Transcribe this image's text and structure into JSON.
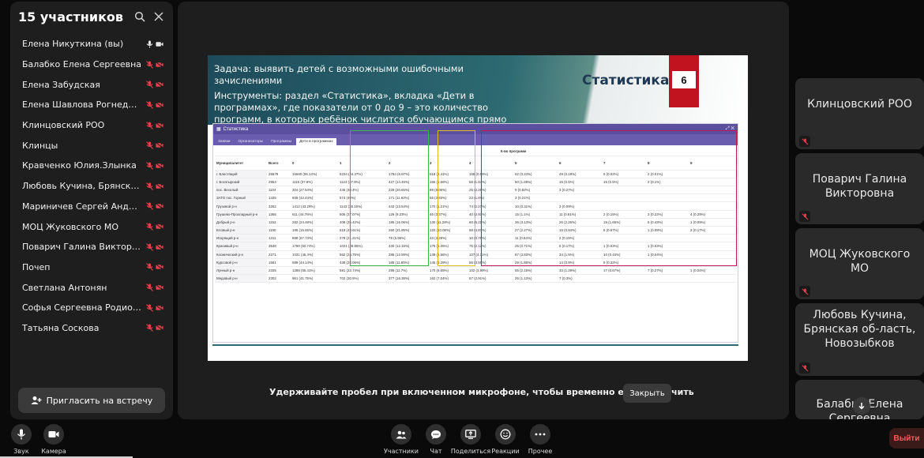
{
  "sidebar": {
    "title": "15 участников",
    "invite_label": "Пригласить на встречу",
    "participants": [
      {
        "name": "Елена Никуткина (вы)",
        "muted": false
      },
      {
        "name": "Балабко Елена Сергеевна",
        "muted": true
      },
      {
        "name": "Елена Забудская",
        "muted": true
      },
      {
        "name": "Елена Шавлова Рогнедино",
        "muted": true
      },
      {
        "name": "Клинцовский РОО",
        "muted": true
      },
      {
        "name": "Клинцы",
        "muted": true
      },
      {
        "name": "Кравченко Юлия.Злынка",
        "muted": true
      },
      {
        "name": "Любовь Кучина, Брянская ...",
        "muted": true
      },
      {
        "name": "Мариничев Сергей Андрее...",
        "muted": true
      },
      {
        "name": "МОЦ Жуковского МО",
        "muted": true
      },
      {
        "name": "Поварич Галина Викторовна",
        "muted": true
      },
      {
        "name": "Почеп",
        "muted": true
      },
      {
        "name": "Светлана Антонян",
        "muted": true
      },
      {
        "name": "Софья Сергеевна Родионе...",
        "muted": true
      },
      {
        "name": "Татьяна Соскова",
        "muted": true
      }
    ]
  },
  "slide": {
    "task_line": "Задача: выявить детей с возможными ошибочными зачислениями",
    "tools_line": "Инструменты: раздел «Статистика», вкладка «Дети в программах», где показатели от 0 до 9 – это количество программ, в которых ребёнок числится обучающимся прямо сейчас",
    "title": "Статистика",
    "slide_number": "6",
    "app_title": "Статистика",
    "tabs": [
      "Заявки",
      "Организаторы",
      "Программы",
      "Дети в программах"
    ],
    "group_header": "К-во программ",
    "columns": [
      "Муниципалитет",
      "Всего",
      "0",
      "1",
      "2",
      "3",
      "4",
      "5",
      "6",
      "7",
      "8",
      "9"
    ],
    "rows": [
      [
        "г. Блестящий",
        "25579",
        "16660 (65.13%)",
        "6234 (24.37%)",
        "1784 (6.97%)",
        "616 (2.41%)",
        "165 (0.65%)",
        "62 (0.24%)",
        "49 (0.19%)",
        "6 (0.02%)",
        "2 (0.01%)",
        ""
      ],
      [
        "г. Богатырский",
        "2954",
        "1116 (37.8%)",
        "1123 (37.8%)",
        "427 (14.45%)",
        "166 (5.56%)",
        "58 (1.84%)",
        "50 (1.69%)",
        "15 (0.5%)",
        "15 (0.5%)",
        "2 (0.1%)",
        ""
      ],
      [
        "пос. Веселый",
        "1104",
        "304 (27.54%)",
        "446 (40.4%)",
        "228 (20.65%)",
        "89 (8.06%)",
        "25 (2.26%)",
        "9 (0.82%)",
        "3 (0.27%)",
        "",
        "",
        ""
      ],
      [
        "ЗАТО пос. Горный",
        "1435",
        "609 (42.44%)",
        "574 (40%)",
        "171 (11.92%)",
        "55 (3.83%)",
        "23 (1.6%)",
        "3 (0.21%)",
        "",
        "",
        "",
        ""
      ],
      [
        "Грузовой р-н",
        "3262",
        "1412 (43.29%)",
        "1143 (35.15%)",
        "443 (13.54%)",
        "170 (5.21%)",
        "74 (2.27%)",
        "10 (0.31%)",
        "3 (0.09%)",
        "",
        "",
        ""
      ],
      [
        "Грушево-Прохладный р-н",
        "1365",
        "611 (44.76%)",
        "506 (37.07%)",
        "126 (9.23%)",
        "46 (3.37%)",
        "40 (2.93%)",
        "15 (1.1%)",
        "11 (0.81%)",
        "2 (0.15%)",
        "3 (0.22%)",
        "4 (0.29%)"
      ],
      [
        "Добрый р-н",
        "1152",
        "282 (24.48%)",
        "408 (35.42%)",
        "185 (16.06%)",
        "130 (11.28%)",
        "60 (5.21%)",
        "36 (3.13%)",
        "26 (2.26%)",
        "19 (1.65%)",
        "5 (0.43%)",
        "1 (0.09%)"
      ],
      [
        "Еловый р-н",
        "1190",
        "185 (15.55%)",
        "519 (43.61%)",
        "260 (21.85%)",
        "120 (10.08%)",
        "58 (4.87%)",
        "27 (2.27%)",
        "10 (0.84%)",
        "8 (0.67%)",
        "1 (0.08%)",
        "2 (0.17%)"
      ],
      [
        "Искрящий р-н",
        "1311",
        "888 (67.73%)",
        "278 (21.21%)",
        "78 (5.95%)",
        "43 (3.28%)",
        "10 (0.76%)",
        "11 (0.84%)",
        "2 (0.15%)",
        "",
        "",
        ""
      ],
      [
        "Красивый р-н",
        "3538",
        "1790 (50.74%)",
        "1021 (28.86%)",
        "430 (12.15%)",
        "176 (5.05%)",
        "75 (2.12%)",
        "25 (0.71%)",
        "6 (0.17%)",
        "1 (0.03%)",
        "1 (0.03%)",
        ""
      ],
      [
        "Космический р-н",
        "2271",
        "1031 (45.4%)",
        "562 (24.75%)",
        "286 (12.59%)",
        "149 (6.56%)",
        "107 (4.71%)",
        "87 (3.83%)",
        "34 (1.5%)",
        "10 (0.44%)",
        "1 (0.04%)",
        ""
      ],
      [
        "Курсовой р-н",
        "1561",
        "689 (44.14%)",
        "438 (28.06%)",
        "185 (11.85%)",
        "145 (9.29%)",
        "56 (3.59%)",
        "29 (1.86%)",
        "14 (0.9%)",
        "5 (0.32%)",
        "",
        ""
      ],
      [
        "Лунный р-н",
        "2335",
        "1288 (55.41%)",
        "581 (22.74%)",
        "299 (11.7%)",
        "170 (6.65%)",
        "102 (3.99%)",
        "55 (2.15%)",
        "33 (1.29%)",
        "17 (0.67%)",
        "7 (0.27%)",
        "1 (0.04%)"
      ],
      [
        "Медовый р-н",
        "2302",
        "961 (41.75%)",
        "702 (30.5%)",
        "377 (16.38%)",
        "162 (7.04%)",
        "67 (2.91%)",
        "26 (1.13%)",
        "7 (0.3%)",
        "",
        "",
        ""
      ]
    ]
  },
  "stage": {
    "hint": "Удерживайте пробел при включенном микрофоне, чтобы временно его выключить",
    "close_label": "Закрыть"
  },
  "tiles": [
    {
      "name": "Клинцовский РОО"
    },
    {
      "name": "Поварич Галина Викторовна"
    },
    {
      "name": "МОЦ Жуковского МО"
    },
    {
      "name": "Любовь Кучина, Брянская об-ласть, Новозыбков"
    },
    {
      "name": "Балабко Елена Сергеевна"
    }
  ],
  "toolbar": {
    "sound_label": "Звук",
    "camera_label": "Камера",
    "participants_label": "Участники",
    "chat_label": "Чат",
    "share_label": "Поделиться",
    "reactions_label": "Реакции",
    "more_label": "Прочее",
    "exit_label": "Выйти"
  },
  "colors": {
    "accent_red": "#c1121f",
    "mute_red": "#e0434b",
    "highlight_green": "#3cb54a",
    "highlight_yellow": "#d9c21e",
    "highlight_crimson": "#c2185b",
    "app_purple": "#5b4fa0"
  }
}
